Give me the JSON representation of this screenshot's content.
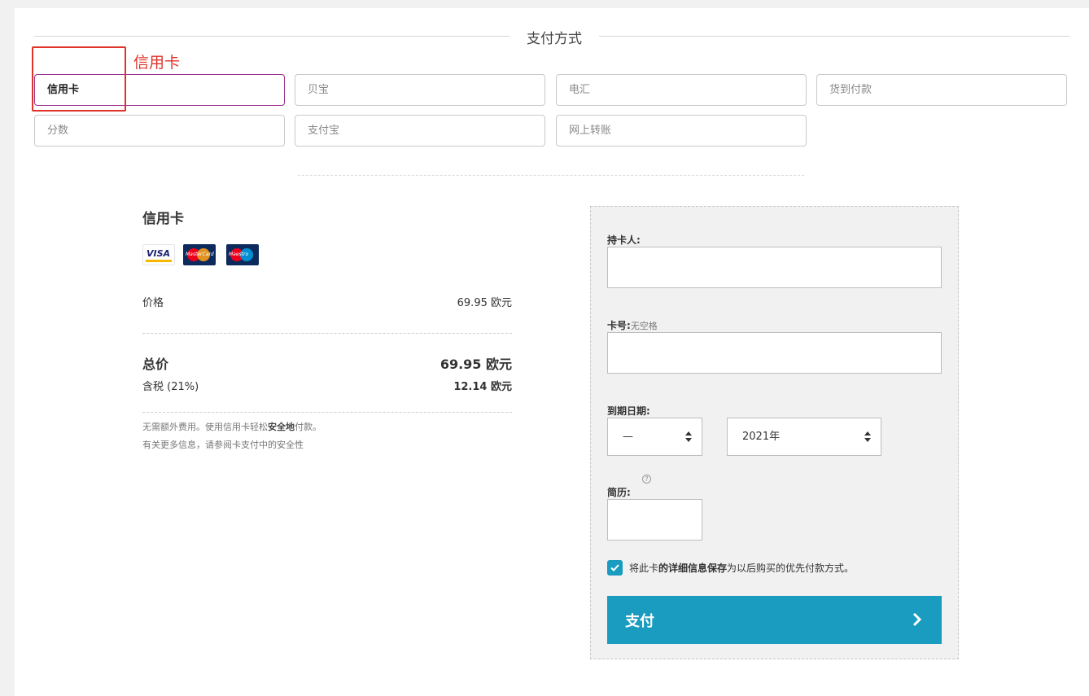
{
  "heading": "支付方式",
  "annotation": {
    "label": "信用卡"
  },
  "tabs": [
    "信用卡",
    "贝宝",
    "电汇",
    "货到付款",
    "分数",
    "支付宝",
    "网上转账"
  ],
  "summary": {
    "title": "信用卡",
    "card_brands": [
      "visa-logo",
      "mastercard-logo",
      "maestro-logo"
    ],
    "visa_text": "VISA",
    "mastercard_text": "MasterCard",
    "maestro_text": "Maestro",
    "price_label": "价格",
    "price_value": "69.95 欧元",
    "total_label": "总价",
    "total_value": "69.95 欧元",
    "tax_label": "含税 (21%)",
    "tax_value": "12.14 欧元",
    "note1_pre": "无需额外费用。使用信用卡轻松",
    "note1_bold": "安全地",
    "note1_post": "付款。",
    "note2": "有关更多信息，请参阅卡支付中的安全性"
  },
  "form": {
    "holder_label": "持卡人:",
    "card_label": "卡号:",
    "card_hint": "无空格",
    "expiry_label": "到期日期:",
    "month_value": "—",
    "year_value": "2021年",
    "cvv_label": "简历:",
    "help_icon": "?",
    "save_pre": "将此卡",
    "save_bold": "的详细信息保存",
    "save_post": "为以后购买的优先付款方式。",
    "pay_label": "支付"
  },
  "colors": {
    "accent": "#1a9cc1",
    "active_tab_border": "#9b2d8c",
    "annotation": "#e0332a"
  }
}
